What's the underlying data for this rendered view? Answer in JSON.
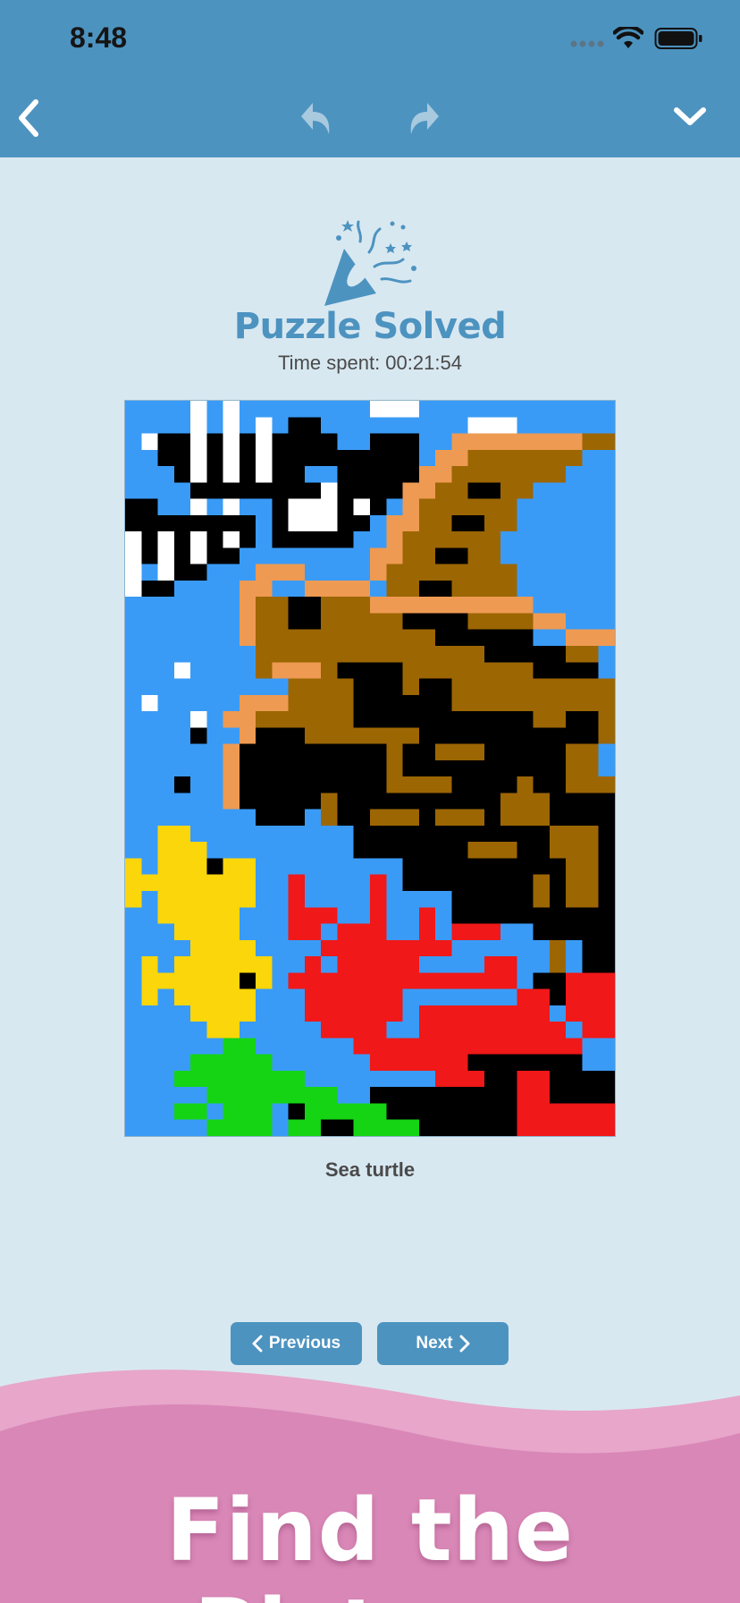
{
  "status_bar": {
    "time": "8:48"
  },
  "header": {
    "solved_title": "Puzzle Solved",
    "time_spent": "Time spent: 00:21:54"
  },
  "puzzle": {
    "caption": "Sea turtle",
    "columns": 30,
    "rows": 45,
    "palette": {
      "water": "#3a9bf7",
      "black": "#000000",
      "white": "#ffffff",
      "shell_brown": "#9c6603",
      "skin_orange": "#ee9a52",
      "fish_yellow": "#fad60a",
      "coral_red": "#f01818",
      "seaweed_green": "#14d414"
    }
  },
  "nav": {
    "previous_label": "Previous",
    "next_label": "Next"
  },
  "banner": {
    "text": "Find the Picture"
  },
  "colors": {
    "accent": "#4d93c0",
    "background": "#d8e8f1",
    "banner_pink": "#d987b7"
  }
}
